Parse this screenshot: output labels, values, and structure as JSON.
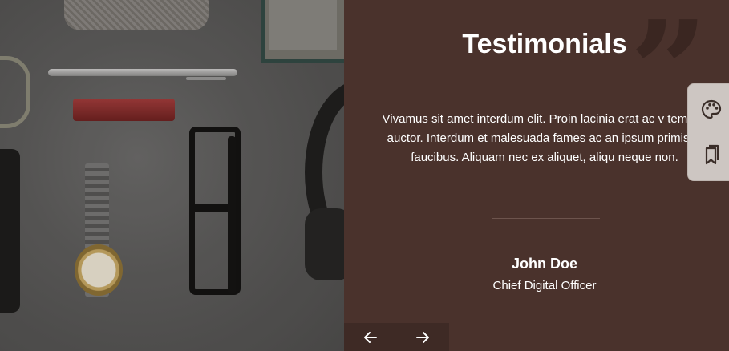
{
  "testimonials": {
    "title": "Testimonials",
    "quote_text": "Vivamus sit amet interdum elit. Proin lacinia erat ac v tempus auctor. Interdum et malesuada fames ac an ipsum primis in faucibus. Aliquam nec ex aliquet, aliqu neque non.",
    "author_name": "John Doe",
    "author_role": "Chief Digital Officer",
    "prev_icon": "arrow-left-icon",
    "next_icon": "arrow-right-icon",
    "quote_glyph": "”"
  },
  "side_toolbar": {
    "items": [
      {
        "icon": "palette-icon"
      },
      {
        "icon": "bookmarks-icon"
      }
    ]
  },
  "colors": {
    "panel_bg": "#4a322c",
    "nav_bg": "#3e2a25",
    "quote_mark": "#3a2621",
    "toolbar_bg": "#cdc6c2",
    "text": "#ffffff"
  }
}
